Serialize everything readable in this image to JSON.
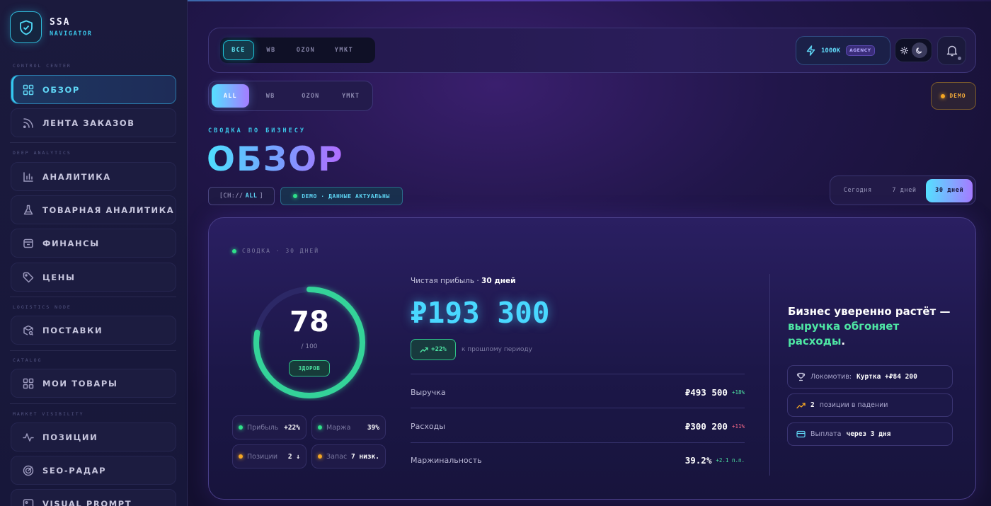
{
  "app": {
    "title": "SSA",
    "subtitle": "NAVIGATOR"
  },
  "sidebar": {
    "sections": {
      "control": "CONTROL CENTER",
      "deep": "DEEP ANALYTICS",
      "logistics": "LOGISTICS NODE",
      "catalog": "CATALOG",
      "market": "MARKET VISIBILITY"
    },
    "items": [
      {
        "label": "ОБЗОР",
        "icon": "grid-icon",
        "active": true
      },
      {
        "label": "ЛЕНТА ЗАКАЗОВ",
        "icon": "rss-icon"
      },
      {
        "label": "АНАЛИТИКА",
        "icon": "bar-chart-icon"
      },
      {
        "label": "ТОВАРНАЯ АНАЛИТИКА",
        "icon": "flask-icon"
      },
      {
        "label": "ФИНАНСЫ",
        "icon": "wallet-icon"
      },
      {
        "label": "ЦЕНЫ",
        "icon": "tag-icon"
      },
      {
        "label": "ПОСТАВКИ",
        "icon": "package-search-icon"
      },
      {
        "label": "МОИ ТОВАРЫ",
        "icon": "grid-icon"
      },
      {
        "label": "ПОЗИЦИИ",
        "icon": "activity-icon"
      },
      {
        "label": "SEO-РАДАР",
        "icon": "radar-icon"
      },
      {
        "label": "VISUAL PROMPT",
        "icon": "image-icon"
      }
    ]
  },
  "topbar": {
    "marketplaces": [
      "ВСЕ",
      "WB",
      "OZON",
      "YMKT"
    ],
    "active_marketplace": "ВСЕ",
    "agency_amount": "1000К",
    "agency_badge": "AGENCY"
  },
  "filter": {
    "options": [
      "ALL",
      "WB",
      "OZON",
      "YMKT"
    ],
    "active": "ALL"
  },
  "demo_badge": "DEMO",
  "header": {
    "eyebrow": "СВОДКА ПО БИЗНЕСУ",
    "title": "ОБЗОР",
    "channel_prefix": "[CH://",
    "channel_value": "ALL",
    "channel_suffix": "]",
    "demo_status": "DEMO · ДАННЫЕ АКТУАЛЬНЫ"
  },
  "period": {
    "options": [
      "Сегодня",
      "7 дней",
      "30 дней"
    ],
    "active": "30 дней"
  },
  "summary": {
    "eyebrow": "СВОДКА · 30 ДНЕЙ",
    "score": "78",
    "score_max": "/ 100",
    "score_fraction": 0.78,
    "score_status": "ЗДОРОВ",
    "minis": [
      {
        "label": "Прибыль",
        "value": "+22%",
        "color": "#2fe08a"
      },
      {
        "label": "Маржа",
        "value": "39%",
        "color": "#2fe08a"
      },
      {
        "label": "Позиции",
        "value": "2 ↓",
        "color": "#f5a623"
      },
      {
        "label": "Запасы",
        "value": "7 низк.",
        "color": "#f5a623"
      }
    ],
    "net_profit_label": "Чистая прибыль",
    "net_profit_period": "30 дней",
    "net_profit_value": "₽193 300",
    "trend_value": "+22%",
    "trend_note": "к прошлому периоду",
    "rows": [
      {
        "label": "Выручка",
        "value": "₽493 500",
        "delta": "+18%",
        "delta_color": "#4ee6a4"
      },
      {
        "label": "Расходы",
        "value": "₽300 200",
        "delta": "+11%",
        "delta_color": "#ff6b8a"
      },
      {
        "label": "Маржинальность",
        "value": "39.2%",
        "delta": "+2.1 п.п.",
        "delta_color": "#4ee6a4"
      }
    ],
    "headline_part1": "Бизнес уверенно растёт — ",
    "headline_part2": "выручка обгоняет расходы",
    "headline_part3": ".",
    "insights": [
      {
        "label": "Локомотив:",
        "value": "Куртка +₽84 200",
        "icon": "trophy-icon"
      },
      {
        "label": "позиции в падении",
        "value": "2",
        "icon": "trending-icon"
      },
      {
        "label": "Выплата",
        "value": "через 3 дня",
        "icon": "card-icon"
      }
    ]
  }
}
